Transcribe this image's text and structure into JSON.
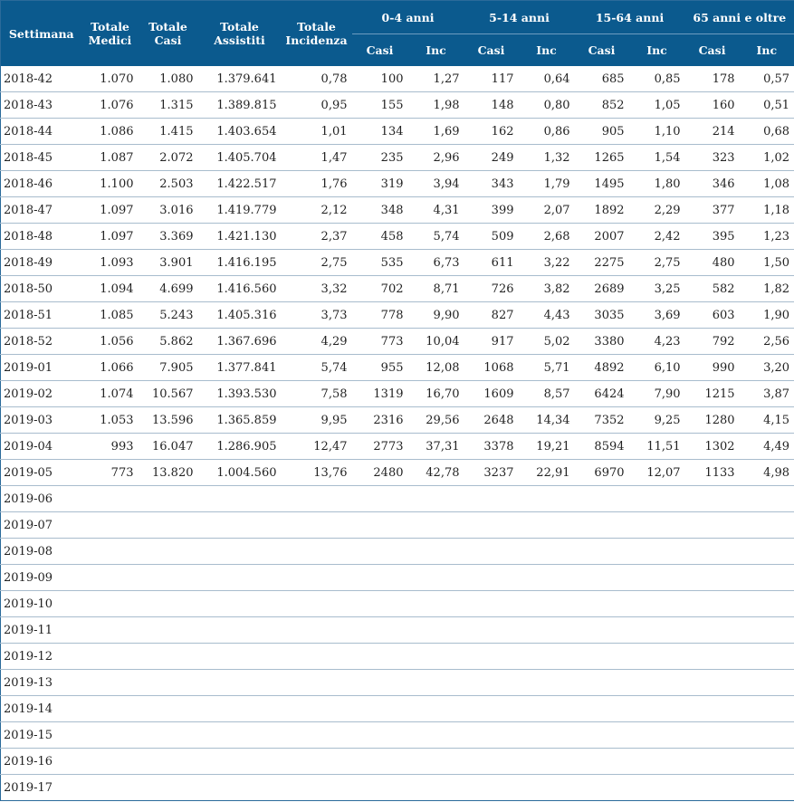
{
  "headers": {
    "week": "Settimana",
    "medici": [
      "Totale",
      "Medici"
    ],
    "casi": [
      "Totale",
      "Casi"
    ],
    "assistiti": [
      "Totale",
      "Assistiti"
    ],
    "incidenza": [
      "Totale",
      "Incidenza"
    ],
    "groups": [
      "0-4 anni",
      "5-14 anni",
      "15-64 anni",
      "65 anni e oltre"
    ],
    "sub": [
      "Casi",
      "Inc"
    ]
  },
  "colors": {
    "header_bg": "#0b5a8e",
    "grid": "#a8bccd"
  },
  "rows": [
    [
      "2018-42",
      "1.070",
      "1.080",
      "1.379.641",
      "0,78",
      "100",
      "1,27",
      "117",
      "0,64",
      "685",
      "0,85",
      "178",
      "0,57"
    ],
    [
      "2018-43",
      "1.076",
      "1.315",
      "1.389.815",
      "0,95",
      "155",
      "1,98",
      "148",
      "0,80",
      "852",
      "1,05",
      "160",
      "0,51"
    ],
    [
      "2018-44",
      "1.086",
      "1.415",
      "1.403.654",
      "1,01",
      "134",
      "1,69",
      "162",
      "0,86",
      "905",
      "1,10",
      "214",
      "0,68"
    ],
    [
      "2018-45",
      "1.087",
      "2.072",
      "1.405.704",
      "1,47",
      "235",
      "2,96",
      "249",
      "1,32",
      "1265",
      "1,54",
      "323",
      "1,02"
    ],
    [
      "2018-46",
      "1.100",
      "2.503",
      "1.422.517",
      "1,76",
      "319",
      "3,94",
      "343",
      "1,79",
      "1495",
      "1,80",
      "346",
      "1,08"
    ],
    [
      "2018-47",
      "1.097",
      "3.016",
      "1.419.779",
      "2,12",
      "348",
      "4,31",
      "399",
      "2,07",
      "1892",
      "2,29",
      "377",
      "1,18"
    ],
    [
      "2018-48",
      "1.097",
      "3.369",
      "1.421.130",
      "2,37",
      "458",
      "5,74",
      "509",
      "2,68",
      "2007",
      "2,42",
      "395",
      "1,23"
    ],
    [
      "2018-49",
      "1.093",
      "3.901",
      "1.416.195",
      "2,75",
      "535",
      "6,73",
      "611",
      "3,22",
      "2275",
      "2,75",
      "480",
      "1,50"
    ],
    [
      "2018-50",
      "1.094",
      "4.699",
      "1.416.560",
      "3,32",
      "702",
      "8,71",
      "726",
      "3,82",
      "2689",
      "3,25",
      "582",
      "1,82"
    ],
    [
      "2018-51",
      "1.085",
      "5.243",
      "1.405.316",
      "3,73",
      "778",
      "9,90",
      "827",
      "4,43",
      "3035",
      "3,69",
      "603",
      "1,90"
    ],
    [
      "2018-52",
      "1.056",
      "5.862",
      "1.367.696",
      "4,29",
      "773",
      "10,04",
      "917",
      "5,02",
      "3380",
      "4,23",
      "792",
      "2,56"
    ],
    [
      "2019-01",
      "1.066",
      "7.905",
      "1.377.841",
      "5,74",
      "955",
      "12,08",
      "1068",
      "5,71",
      "4892",
      "6,10",
      "990",
      "3,20"
    ],
    [
      "2019-02",
      "1.074",
      "10.567",
      "1.393.530",
      "7,58",
      "1319",
      "16,70",
      "1609",
      "8,57",
      "6424",
      "7,90",
      "1215",
      "3,87"
    ],
    [
      "2019-03",
      "1.053",
      "13.596",
      "1.365.859",
      "9,95",
      "2316",
      "29,56",
      "2648",
      "14,34",
      "7352",
      "9,25",
      "1280",
      "4,15"
    ],
    [
      "2019-04",
      "993",
      "16.047",
      "1.286.905",
      "12,47",
      "2773",
      "37,31",
      "3378",
      "19,21",
      "8594",
      "11,51",
      "1302",
      "4,49"
    ],
    [
      "2019-05",
      "773",
      "13.820",
      "1.004.560",
      "13,76",
      "2480",
      "42,78",
      "3237",
      "22,91",
      "6970",
      "12,07",
      "1133",
      "4,98"
    ],
    [
      "2019-06"
    ],
    [
      "2019-07"
    ],
    [
      "2019-08"
    ],
    [
      "2019-09"
    ],
    [
      "2019-10"
    ],
    [
      "2019-11"
    ],
    [
      "2019-12"
    ],
    [
      "2019-13"
    ],
    [
      "2019-14"
    ],
    [
      "2019-15"
    ],
    [
      "2019-16"
    ],
    [
      "2019-17"
    ]
  ]
}
